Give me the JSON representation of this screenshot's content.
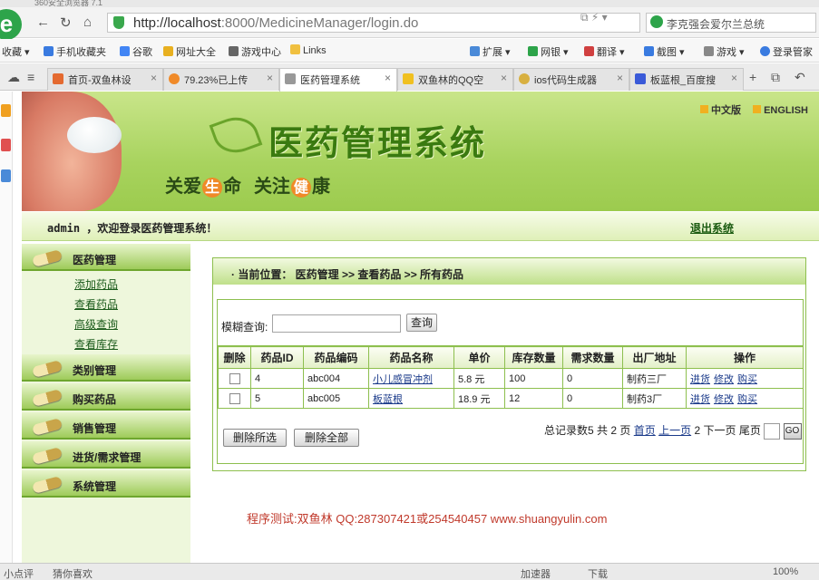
{
  "browser": {
    "title_text": "360安全浏览器 7.1",
    "url_host": "http://localhost",
    "url_rest": ":8000/MedicineManager/login.do",
    "search_text": "李克强会爱尔兰总统",
    "bookmarks": [
      "收藏",
      "手机收藏夹",
      "谷歌",
      "网址大全",
      "游戏中心",
      "Links",
      "扩展",
      "网银",
      "翻译",
      "截图",
      "游戏",
      "登录管家"
    ],
    "tabs": [
      "首页-双鱼林设",
      "79.23%已上传",
      "医药管理系统",
      "双鱼林的QQ空",
      "ios代码生成器",
      "板蓝根_百度搜"
    ],
    "active_tab_index": 2,
    "status_left": "小点评",
    "status_guess": "猜你喜欢",
    "status_accel": "加速器",
    "status_download": "下载",
    "status_zoom": "100%"
  },
  "header": {
    "system_title": "医药管理系统",
    "slogan_1a": "关爱",
    "slogan_1b": "生",
    "slogan_1c": "命",
    "slogan_2a": "关注",
    "slogan_2b": "健",
    "slogan_2c": "康",
    "lang_cn": "中文版",
    "lang_en": "ENGLISH"
  },
  "welcome": {
    "text": "admin ，欢迎登录医药管理系统！",
    "logout": "退出系统"
  },
  "sidebar": {
    "sections": [
      "医药管理",
      "类别管理",
      "购买药品",
      "销售管理",
      "进货/需求管理",
      "系统管理"
    ],
    "sub_items": [
      "添加药品",
      "查看药品",
      "高级查询",
      "查看库存"
    ]
  },
  "breadcrumb": "· 当前位置： 医药管理 >> 查看药品 >> 所有药品",
  "search": {
    "label": "模糊查询:",
    "value": "",
    "button": "查询"
  },
  "table": {
    "headers": [
      "删除",
      "药品ID",
      "药品编码",
      "药品名称",
      "单价",
      "库存数量",
      "需求数量",
      "出厂地址",
      "操作"
    ],
    "rows": [
      {
        "id": "4",
        "code": "abc004",
        "name": "小儿感冒冲剂",
        "price": "5.8 元",
        "stock": "100",
        "demand": "0",
        "factory": "制药三厂"
      },
      {
        "id": "5",
        "code": "abc005",
        "name": "板蓝根",
        "price": "18.9 元",
        "stock": "12",
        "demand": "0",
        "factory": "制药3厂"
      }
    ],
    "ops": [
      "进货",
      "修改",
      "购买"
    ]
  },
  "actions": {
    "delete_selected": "删除所选",
    "delete_all": "删除全部"
  },
  "pager": {
    "total_prefix": "总记录数5 共",
    "total_pages": "2",
    "pages_unit": "页",
    "first": "首页",
    "prev": "上一页",
    "current": "2",
    "next": "下一页",
    "last": "尾页",
    "go": "GO"
  },
  "footer": "程序测试:双鱼林 QQ:287307421或254540457 www.shuangyulin.com",
  "colors": {
    "header_green": "#a8d35e",
    "border_green": "#8dbf4e",
    "footer_red": "#c0392b",
    "link_blue": "#1a3a8a"
  }
}
